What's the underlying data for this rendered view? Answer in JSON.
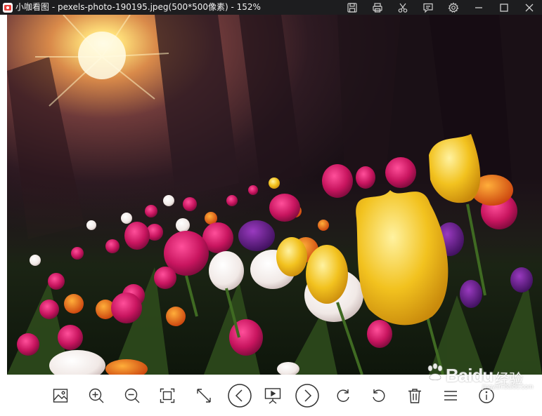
{
  "window": {
    "title": "小咖看图 - pexels-photo-190195.jpeg(500*500像素) - 152%"
  },
  "title_tools": [
    {
      "name": "save-icon"
    },
    {
      "name": "print-icon"
    },
    {
      "name": "scissors-icon"
    },
    {
      "name": "comment-icon"
    },
    {
      "name": "gear-icon"
    },
    {
      "name": "minimize-icon"
    },
    {
      "name": "maximize-icon"
    },
    {
      "name": "close-icon"
    }
  ],
  "toolbar": [
    {
      "name": "image-icon"
    },
    {
      "name": "zoom-in-icon"
    },
    {
      "name": "zoom-out-icon"
    },
    {
      "name": "actual-size-icon"
    },
    {
      "name": "fit-window-icon"
    },
    {
      "name": "previous-icon"
    },
    {
      "name": "slideshow-icon"
    },
    {
      "name": "next-icon"
    },
    {
      "name": "rotate-right-icon"
    },
    {
      "name": "rotate-left-icon"
    },
    {
      "name": "trash-icon"
    },
    {
      "name": "menu-icon"
    },
    {
      "name": "info-icon"
    }
  ],
  "watermark": {
    "brand": "Baidu",
    "cn": "经验",
    "sub": "jingyan.baidu.com"
  },
  "colors": {
    "titlebar": "#1d1d1f",
    "icon": "#333333",
    "yellow_tulip": "#f2c21f",
    "magenta_tulip": "#c8155f"
  }
}
